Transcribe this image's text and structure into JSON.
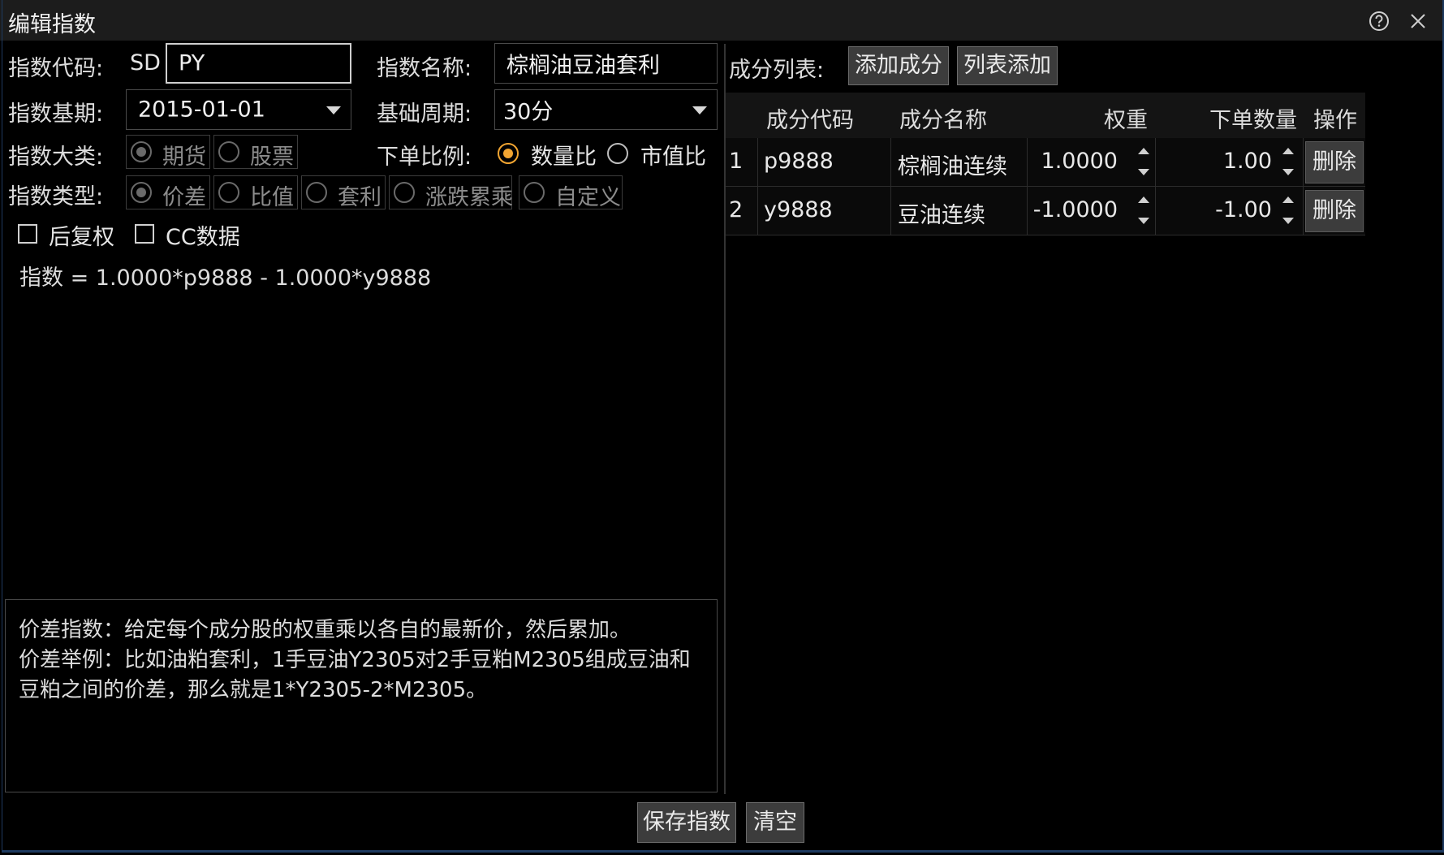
{
  "window": {
    "title": "编辑指数"
  },
  "form": {
    "code_label": "指数代码:",
    "code_prefix": "SD",
    "code_value": "PY",
    "name_label": "指数名称:",
    "name_value": "棕榈油豆油套利",
    "base_period_label": "指数基期:",
    "base_period_value": "2015-01-01",
    "cycle_label": "基础周期:",
    "cycle_value": "30分",
    "category_label": "指数大类:",
    "category_options": [
      "期货",
      "股票"
    ],
    "category_selected": "期货",
    "ratio_label": "下单比例:",
    "ratio_options": [
      "数量比",
      "市值比"
    ],
    "ratio_selected": "数量比",
    "type_label": "指数类型:",
    "type_options": [
      "价差",
      "比值",
      "套利",
      "涨跌累乘",
      "自定义"
    ],
    "type_selected": "价差",
    "check_adjust_label": "后复权",
    "check_adjust_checked": false,
    "check_cc_label": "CC数据",
    "check_cc_checked": false,
    "formula": "指数 = 1.0000*p9888 - 1.0000*y9888"
  },
  "description": {
    "lines": [
      "价差指数：给定每个成分股的权重乘以各自的最新价，然后累加。",
      "价差举例：比如油粕套利，1手豆油Y2305对2手豆粕M2305组成豆油和",
      "豆粕之间的价差，那么就是1*Y2305-2*M2305。"
    ]
  },
  "components": {
    "label": "成分列表:",
    "add_button": "添加成分",
    "list_add_button": "列表添加",
    "columns": [
      "成分代码",
      "成分名称",
      "权重",
      "下单数量",
      "操作"
    ],
    "rows": [
      {
        "index": "1",
        "code": "p9888",
        "name": "棕榈油连续",
        "weight": "1.0000",
        "qty": "1.00",
        "action": "删除"
      },
      {
        "index": "2",
        "code": "y9888",
        "name": "豆油连续",
        "weight": "-1.0000",
        "qty": "-1.00",
        "action": "删除"
      }
    ]
  },
  "footer": {
    "save_button": "保存指数",
    "clear_button": "清空"
  },
  "colors": {
    "accent": "#f2a531",
    "background": "#000000",
    "border": "#1e3a60"
  },
  "icons": [
    "help-icon",
    "close-icon",
    "dropdown-caret-icon",
    "spin-up-icon",
    "spin-down-icon"
  ]
}
